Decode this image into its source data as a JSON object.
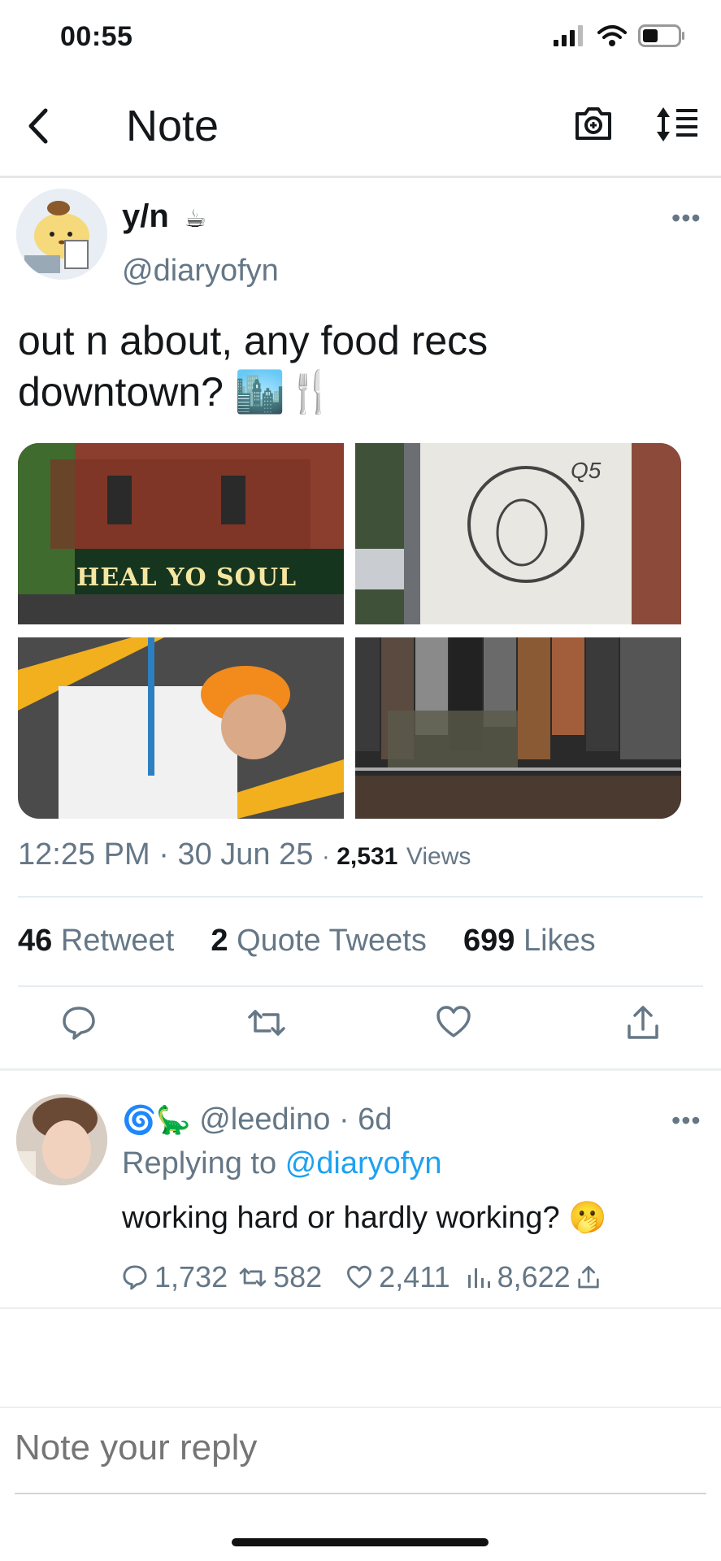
{
  "status": {
    "time": "00:55"
  },
  "nav": {
    "title": "Note",
    "camera_icon": "camera-icon",
    "sort_icon": "sort-icon"
  },
  "tweet": {
    "name": "y/n",
    "name_emoji": "☕",
    "handle": "@diaryofyn",
    "text_line1": "out n about, any food recs",
    "text_line2": "downtown? 🏙️🍴",
    "images": [
      {
        "caption": "HEAL YO SOUL"
      },
      {
        "caption": "Q5"
      },
      {
        "caption": ""
      },
      {
        "caption": ""
      }
    ],
    "time": "12:25 PM",
    "date": "30 Jun 25",
    "views_count": "2,531",
    "views_label": "Views",
    "retweets_count": "46",
    "retweets_label": "Retweet",
    "quotes_count": "2",
    "quotes_label": "Quote Tweets",
    "likes_count": "699",
    "likes_label": "Likes"
  },
  "reply": {
    "emojis": "🌀🦕",
    "handle": "@leedino",
    "age": "6d",
    "replying_prefix": "Replying to",
    "replying_to": "@diaryofyn",
    "text": "working hard or hardly working? 🫢",
    "replies": "1,732",
    "retweets": "582",
    "likes": "2,411",
    "views": "8,622"
  },
  "composer": {
    "placeholder": "Note your reply"
  },
  "colors": {
    "accent": "#1da1f2",
    "muted": "#657786",
    "text": "#14171a"
  }
}
